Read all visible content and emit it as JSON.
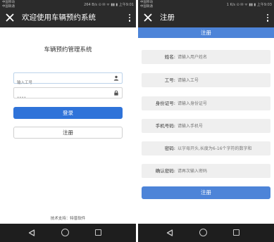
{
  "status_bar": {
    "carrier_line1": "中国移动",
    "carrier_line2": "中国联通",
    "left_screen_right": "264 B/s ⊙ ✉ ᯤ ▮▮ ▮ 上午9:01",
    "right_screen_right": "1 K/s ⊙ ✉ ᯤ ▮▮ ▮ 上午9:03"
  },
  "login_screen": {
    "toolbar_title": "欢迎使用车辆预约系统",
    "app_title": "车辆预约管理系统",
    "username_placeholder": "输入工号",
    "password_value": "••••",
    "login_label": "登录",
    "register_label": "注册",
    "support_text": "技术支持：特普软件"
  },
  "register_screen": {
    "toolbar_title": "注册",
    "header_title": "注册",
    "fields": [
      {
        "label": "姓名:",
        "placeholder": "请输入用户姓名"
      },
      {
        "label": "工号:",
        "placeholder": "请输入工号"
      },
      {
        "label": "身份证号:",
        "placeholder": "请输入身份证号"
      },
      {
        "label": "手机号码:",
        "placeholder": "请输入手机号"
      },
      {
        "label": "密码:",
        "placeholder": "以字母开头,长度为6-16个字符的数字和"
      },
      {
        "label": "确认密码:",
        "placeholder": "请再次输入密码"
      }
    ],
    "submit_label": "注册"
  },
  "icons": {
    "close": "close-icon",
    "more": "more-vertical-icon",
    "user": "user-icon",
    "lock": "lock-icon",
    "back": "back-triangle-icon",
    "home": "home-circle-icon",
    "recent": "recent-square-icon"
  },
  "colors": {
    "toolbar": "#2b2b2b",
    "primary_button": "#2f73d9",
    "register_blue": "#4d84d8",
    "field_bg": "#efefef",
    "nav_bar": "#1e1e1e"
  }
}
